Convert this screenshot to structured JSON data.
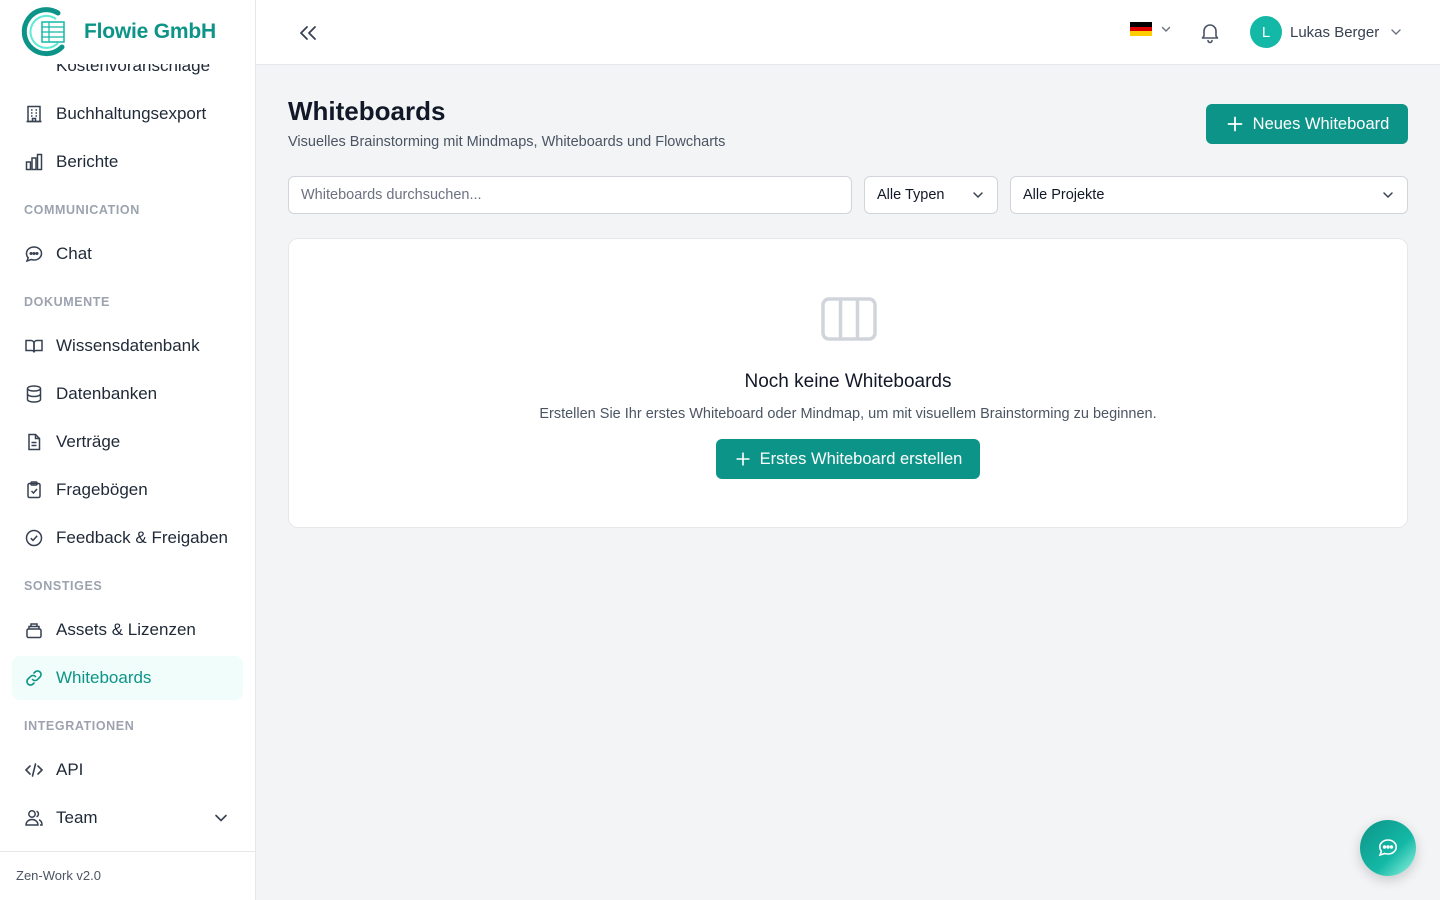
{
  "brand": {
    "name": "Flowie GmbH"
  },
  "sidebar": {
    "partial_item": "Kostenvoranschläge",
    "items_top": [
      {
        "label": "Buchhaltungsexport",
        "icon": "building-icon"
      },
      {
        "label": "Berichte",
        "icon": "bar-chart-icon"
      }
    ],
    "sections": {
      "communication": "COMMUNICATION",
      "dokumente": "DOKUMENTE",
      "sonstiges": "SONSTIGES",
      "integrationen": "INTEGRATIONEN"
    },
    "chat": {
      "label": "Chat"
    },
    "wissensdatenbank": {
      "label": "Wissensdatenbank"
    },
    "datenbanken": {
      "label": "Datenbanken"
    },
    "vertraege": {
      "label": "Verträge"
    },
    "frageboegen": {
      "label": "Fragebögen"
    },
    "feedback": {
      "label": "Feedback & Freigaben"
    },
    "assets": {
      "label": "Assets & Lizenzen"
    },
    "whiteboards": {
      "label": "Whiteboards",
      "active": true
    },
    "api": {
      "label": "API"
    },
    "team": {
      "label": "Team"
    },
    "footer": "Zen-Work v2.0"
  },
  "header": {
    "language": "de",
    "user": {
      "initial": "L",
      "name": "Lukas Berger"
    }
  },
  "main": {
    "title": "Whiteboards",
    "subtitle": "Visuelles Brainstorming mit Mindmaps, Whiteboards und Flowcharts",
    "new_button": "Neues Whiteboard",
    "search_placeholder": "Whiteboards durchsuchen...",
    "filter_type": "Alle Typen",
    "filter_project": "Alle Projekte",
    "empty": {
      "title": "Noch keine Whiteboards",
      "text": "Erstellen Sie Ihr erstes Whiteboard oder Mindmap, um mit visuellem Brainstorming zu beginnen.",
      "button": "Erstes Whiteboard erstellen"
    }
  },
  "colors": {
    "accent": "#0d9488",
    "accent_light": "#f0fdfa"
  }
}
